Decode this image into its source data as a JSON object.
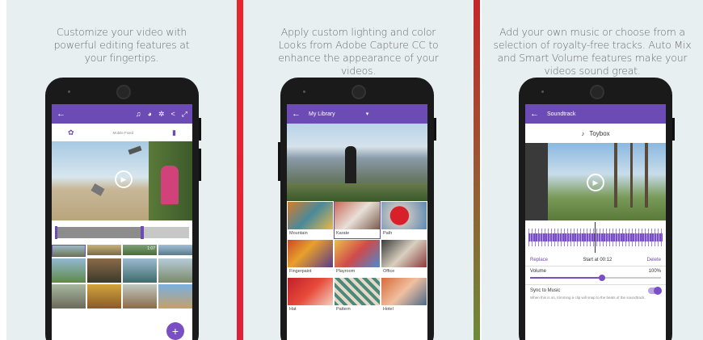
{
  "panels": [
    {
      "caption": "Customize your video with powerful editing features at your fingertips.",
      "icons": [
        "back-arrow-icon",
        "music-note-icon",
        "palette-icon",
        "gear-icon",
        "share-icon",
        "expand-icon"
      ],
      "toolbar": {
        "settings_icon": "gear-icon",
        "center_label": "Mobile Fixed",
        "trash_icon": "trash-icon"
      },
      "fab_label": "+",
      "thumb_count_label": "1:07"
    },
    {
      "caption": "Apply custom lighting and color Looks from Adobe Capture CC to enhance the appearance of your videos.",
      "header": {
        "title": "My Library",
        "dropdown_icon": "▾"
      },
      "looks": [
        "Mountain",
        "Karate",
        "Path",
        "Fingerpaint",
        "Playroom",
        "Office",
        "Hat",
        "Pattern",
        "Hotel"
      ],
      "selected_look": "Karate"
    },
    {
      "caption": "Add your own music or choose from a selection of royalty-free tracks. Auto Mix and Smart Volume features make your videos sound great.",
      "header": {
        "title": "Soundtrack"
      },
      "track": {
        "icon": "♪",
        "name": "Toybox"
      },
      "controls": {
        "replace": "Replace",
        "start": "Start at 00:12",
        "delete": "Delete"
      },
      "volume": {
        "label": "Volume",
        "value": "100%",
        "level": 0.55
      },
      "sync": {
        "label": "Sync to Music",
        "on": true,
        "hint": "When this is on, trimming a clip will snap to the beats of the soundtrack."
      }
    }
  ],
  "colors": {
    "accent": "#6c4bb5",
    "separator_red": "#e8262d",
    "separator_green": "#6d8a3a"
  }
}
